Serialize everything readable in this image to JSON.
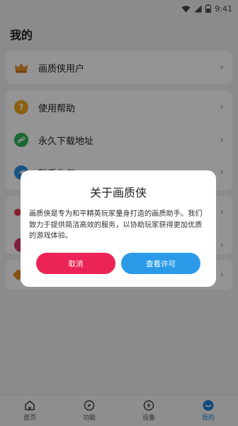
{
  "status_bar": {
    "time": "9:41"
  },
  "header": {
    "title": "我的"
  },
  "card_user": {
    "items": [
      {
        "label": "画质侠用户",
        "icon": "crown-icon"
      }
    ]
  },
  "card_help": {
    "items": [
      {
        "label": "使用帮助",
        "icon": "question-icon"
      },
      {
        "label": "永久下载地址",
        "icon": "link-icon"
      },
      {
        "label": "联系作者",
        "icon": "send-icon"
      }
    ]
  },
  "dialog": {
    "title": "关于画质侠",
    "body": "画质侠是专为和平精英玩家量身打造的画质助手。我们致力于提供简洁高效的服务，以协助玩家获得更加优质的游戏体验。",
    "cancel_label": "取消",
    "license_label": "查看许可"
  },
  "tabbar": {
    "tabs": [
      {
        "label": "首页",
        "icon": "home-icon"
      },
      {
        "label": "功能",
        "icon": "compass-icon"
      },
      {
        "label": "设备",
        "icon": "lightning-icon"
      },
      {
        "label": "我的",
        "icon": "profile-icon",
        "active": true
      }
    ]
  },
  "colors": {
    "accent": "#1a7fd4",
    "cancel": "#ec2456",
    "confirm": "#2b9be9"
  }
}
